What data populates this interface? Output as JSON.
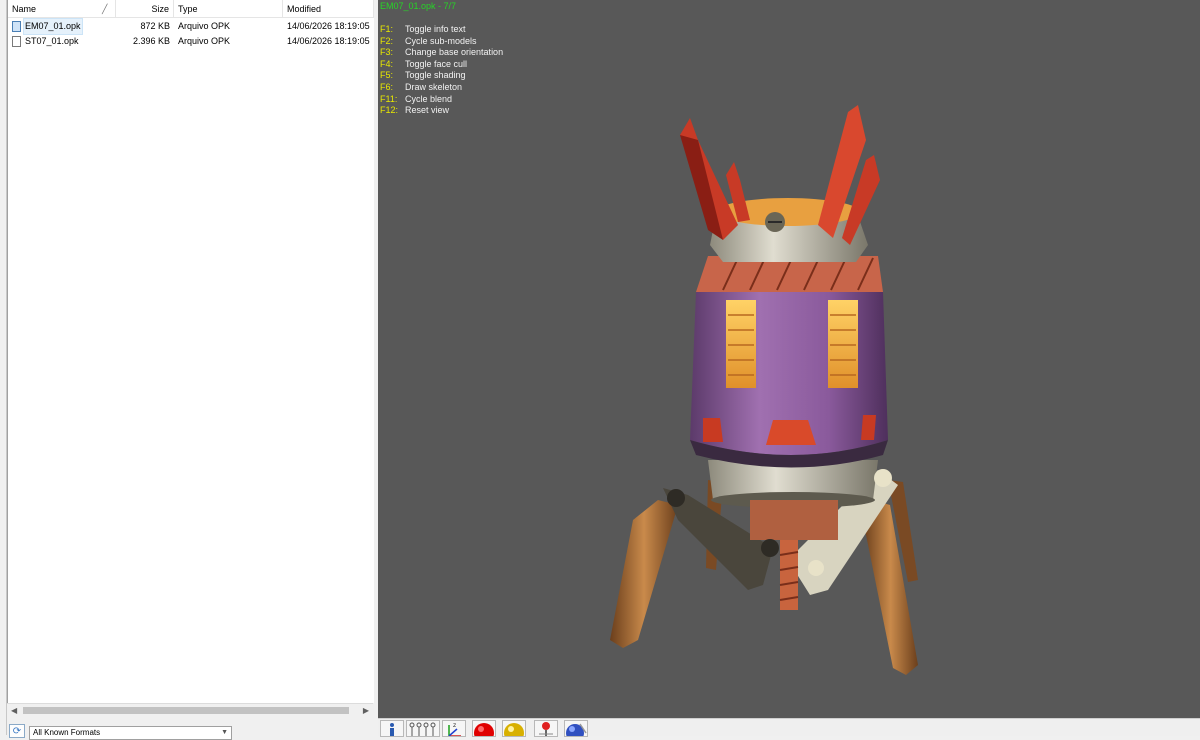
{
  "file_list": {
    "columns": {
      "name": "Name",
      "size": "Size",
      "type": "Type",
      "modified": "Modified"
    },
    "files": [
      {
        "name": "EM07_01.opk",
        "size": "872 KB",
        "type": "Arquivo OPK",
        "modified": "14/06/2026 18:19:05",
        "icon": "opk-file-icon",
        "selected": true
      },
      {
        "name": "ST07_01.opk",
        "size": "2.396 KB",
        "type": "Arquivo OPK",
        "modified": "14/06/2026 18:19:05",
        "icon": "blank-file-icon",
        "selected": false
      }
    ]
  },
  "format_filter": {
    "selected": "All Known Formats"
  },
  "viewer": {
    "title": "EM07_01.opk - 7/7",
    "background": "#585858",
    "help": [
      {
        "key": "F1:",
        "action": "Toggle info text"
      },
      {
        "key": "F2:",
        "action": "Cycle sub-models"
      },
      {
        "key": "F3:",
        "action": "Change base orientation"
      },
      {
        "key": "F4:",
        "action": "Toggle face cull"
      },
      {
        "key": "F5:",
        "action": "Toggle shading"
      },
      {
        "key": "F6:",
        "action": "Draw skeleton"
      },
      {
        "key": "F11:",
        "action": "Cycle blend"
      },
      {
        "key": "F12:",
        "action": "Reset view"
      }
    ]
  },
  "toolbar": {
    "buttons": [
      "info-icon",
      "skeleton-icon",
      "axes-icon",
      "red-sphere-icon",
      "yellow-sphere-icon",
      "light-icon",
      "texture-sphere-icon"
    ]
  },
  "colors": {
    "title_green": "#27d327",
    "key_yellow": "#e8e800",
    "help_text": "#f2f2f2"
  }
}
